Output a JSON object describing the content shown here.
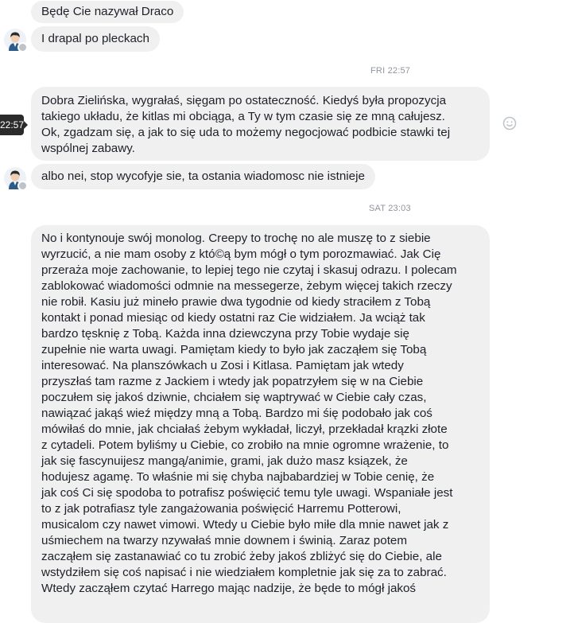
{
  "messages": [
    {
      "text": "Będę Cie nazywał Draco"
    },
    {
      "text": "I drapal po pleckach"
    },
    {
      "text": "Dobra Zielińska, wygrałaś, sięgam po ostateczność. Kiedyś była propozycja\ntakiego układu, że kitlas mi obciąga, a Ty w tym czasie się ze mną całujesz.\nOk, zgadzam się, a jak to się uda to możemy negocjować podbicie stawki tej\nwspólnej zabawy."
    },
    {
      "text": "albo nei, stop wycofyje sie, ta ostania wiadomosc nie istnieje"
    },
    {
      "text": "No i kontynouje swój monolog. Creepy to trochę no ale muszę to z siebie\nwyrzucić, a nie mam osoby z któ©ą bym mógł o tym porozmawiać. Jak Cię\nprzeraża moje zachowanie, to lepiej tego nie czytaj i skasuj odrazu. I polecam\nzablokować wiadomości odmnie na messegerze, żebym więcej takich rzeczy\nnie robił. Kasiu już mineło prawie dwa tygodnie od kiedy straciłem z Tobą\nkontakt i ponad miesiąc od kiedy ostatni raz Cie widziałem. Ja wciąż tak\nbardzo tęsknię z Tobą. Każda inna dziewczyna przy Tobie wydaje się\nzupełnie nie warta uwagi. Pamiętam kiedy to było jak zacząłem się Tobą\ninteresować. Na planszówkach u Zosi i Kitlasa. Pamiętam jak wtedy\nprzyszłaś tam razme z Jackiem i wtedy jak popatrzyłem się w na Ciebie\npoczułem się jakoś dziwnie, chciałem się waptrywać w Ciebie cały czas,\nnawiązać jakąś wieź między mną a Tobą. Bardzo mi śię podobało jak coś\nmówiłaś do mnie, jak chciałaś żebym wykładał, liczył, przekładał krązki złote\nz cytadeli. Potem byliśmy u Ciebie, co zrobiło na mnie ogromne wrażenie, to\njak się fascynuijesz mangą/animie, grami, jak dużo masz ksiązek, że\nhodujesz agamę. To właśnie mi się chyba najbabardziej w Tobie cenię, że\njak coś Ci się spodoba to potrafisz poświęcić temu tyle uwagi. Wspaniałe jest\nto z jak potrafiasz tyle zangażowania poświęcić Harremu Potterowi,\nmusicalom czy nawet vimowi. Wtedy u Ciebie było miłe dla mnie nawet jak z\nuśmiechem na twarzy nzywałaś mnie downem i świnią. Zaraz potem\nzacząłem się zastanawiać co tu zrobić żeby jakoś zbliżyć się do Ciebie, ale\nwstydziłem się coś napisać i nie wiedziałem kompletnie jak się za to zabrać.\nWtedy zacząłem czytać Harrego mając nadzije, że będe to mógł jakoś"
    }
  ],
  "timestamps": {
    "fri": "FRI 22:57",
    "sat": "SAT 23:03"
  },
  "hover_time": "22:57",
  "icons": {
    "avatar": "avatar-icon",
    "emoji": "emoji-smile-icon",
    "status": "status-dot-icon"
  }
}
